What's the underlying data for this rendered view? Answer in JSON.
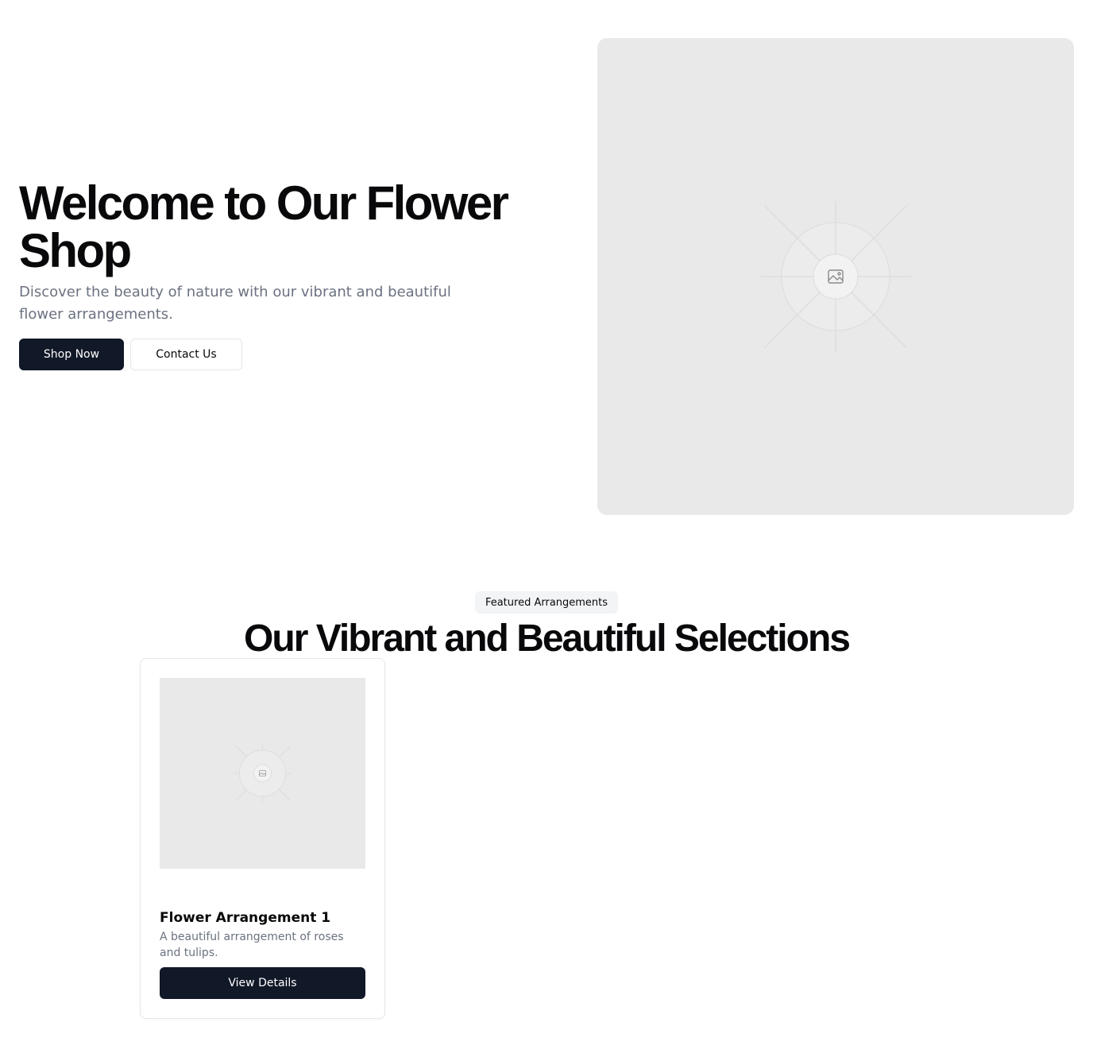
{
  "hero": {
    "title": "Welcome to Our Flower Shop",
    "subtitle": "Discover the beauty of nature with our vibrant and beautiful flower arrangements.",
    "primary_button": "Shop Now",
    "secondary_button": "Contact Us",
    "image_icon": "image-placeholder-icon"
  },
  "featured": {
    "badge": "Featured Arrangements",
    "title": "Our Vibrant and Beautiful Selections",
    "cards": [
      {
        "title": "Flower Arrangement 1",
        "description": "A beautiful arrangement of roses and tulips.",
        "button": "View Details",
        "image_icon": "image-placeholder-icon"
      }
    ]
  },
  "colors": {
    "primary": "#111827",
    "placeholder_bg": "#e9e9e9",
    "muted_text": "#6b7280",
    "border": "#e5e7eb"
  }
}
